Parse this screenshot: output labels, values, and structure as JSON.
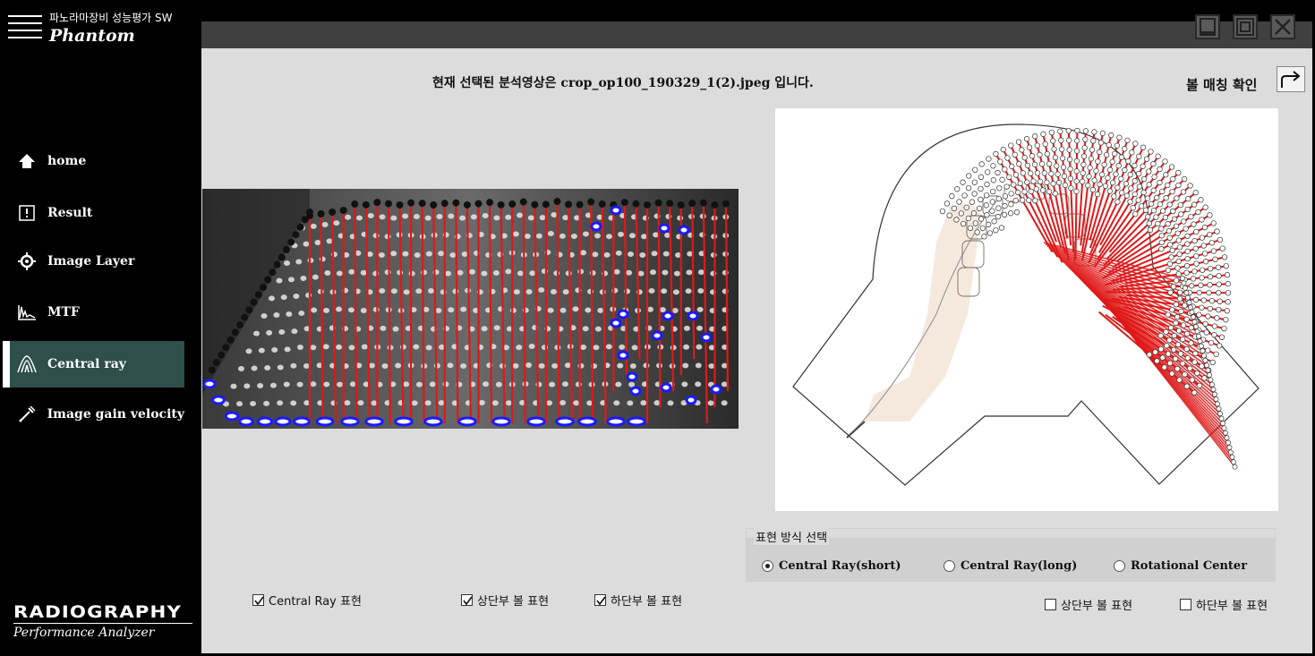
{
  "app": {
    "title_ko": "파노라마장비 성능평가 SW",
    "title_en": "Phantom",
    "brand_primary": "RADIOGRAPHY",
    "brand_secondary": "Performance Analyzer"
  },
  "sidebar": {
    "items": [
      {
        "label": "home",
        "icon": "home-icon",
        "active": false
      },
      {
        "label": "Result",
        "icon": "result-icon",
        "active": false
      },
      {
        "label": "Image Layer",
        "icon": "image-layer-icon",
        "active": false
      },
      {
        "label": "MTF",
        "icon": "mtf-icon",
        "active": false
      },
      {
        "label": "Central ray",
        "icon": "central-ray-icon",
        "active": true
      },
      {
        "label": "Image gain velocity",
        "icon": "image-gain-velocity-icon",
        "active": false
      }
    ]
  },
  "window_controls": [
    "minimize-icon",
    "maximize-icon",
    "close-icon"
  ],
  "main": {
    "selected_file_text": "현재 선택된 분석영상은 crop_op100_190329_1(2).jpeg 입니다.",
    "ball_match_label": "볼 매칭 확인",
    "ball_match_icon": "redo-arrow-icon"
  },
  "display_mode": {
    "title": "표현 방식 선택",
    "options": [
      {
        "label": "Central Ray(short)",
        "selected": true
      },
      {
        "label": "Central Ray(long)",
        "selected": false
      },
      {
        "label": "Rotational Center",
        "selected": false
      }
    ]
  },
  "left_checkboxes": [
    {
      "label": "Central Ray 표현",
      "checked": true
    },
    {
      "label": "상단부 볼 표현",
      "checked": true
    },
    {
      "label": "하단부 볼 표현",
      "checked": true
    }
  ],
  "right_checkboxes": [
    {
      "label": "상단부 볼 표현",
      "checked": false
    },
    {
      "label": "하단부 볼 표현",
      "checked": false
    }
  ],
  "colors": {
    "sidebar_bg": "#000000",
    "active_item_bg": "#2e4f4a",
    "content_bg": "#dcdcdc",
    "topbar_bg": "#404040",
    "ray_red": "#e01818",
    "ball_blue": "#1a1aff"
  }
}
